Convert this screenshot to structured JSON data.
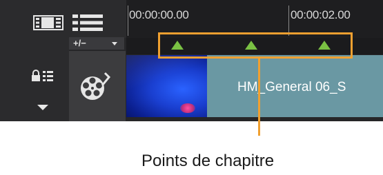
{
  "toolbar": {
    "storyboard_icon": "storyboard-view-icon",
    "list_icon": "list-view-icon",
    "plus_minus_label": "+/−"
  },
  "ruler": {
    "timecodes": [
      "00:00:00.00",
      "00:00:02.00"
    ]
  },
  "chapter_points": {
    "count": 3,
    "marker_color": "#7ac143",
    "highlight_color": "#f0a030"
  },
  "track": {
    "lock_icon": "lock-track-icon",
    "expand_icon": "chevron-down-icon",
    "track_icon": "film-reel-icon",
    "clip_label": "HM_General 06_S",
    "clip_color": "#6a98a3"
  },
  "caption": {
    "text": "Points de chapitre"
  }
}
